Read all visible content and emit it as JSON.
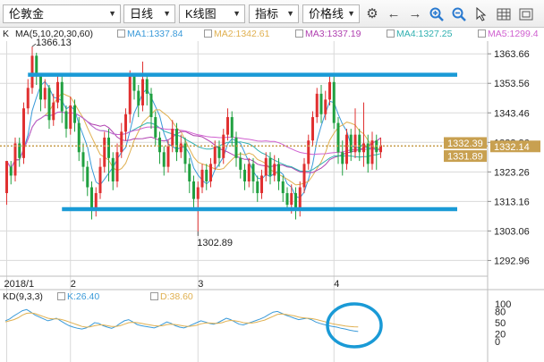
{
  "toolbar": {
    "symbol": "伦敦金",
    "period": "日线",
    "chart_type": "K线图",
    "indicator": "指标",
    "price_line": "价格线"
  },
  "ma_legend": {
    "k_label": "K",
    "params": "MA(5,10,20,30,60)",
    "items": [
      {
        "label": "MA1:1337.84",
        "color": "#3a9ad9"
      },
      {
        "label": "MA2:1342.61",
        "color": "#e0b050"
      },
      {
        "label": "MA3:1337.19",
        "color": "#b040b0"
      },
      {
        "label": "MA4:1327.25",
        "color": "#30b0b0"
      },
      {
        "label": "MA5:1299.4",
        "color": "#d060d0"
      }
    ]
  },
  "kd_legend": {
    "params": "KD(9,3,3)",
    "k_label": "K:26.40",
    "d_label": "D:38.60",
    "k_color": "#3a9ad9",
    "d_color": "#e0b050"
  },
  "colors": {
    "up": "#e03030",
    "down": "#20a040",
    "annotation": "#1a9ad6",
    "axis_text": "#222222",
    "grid": "#d9d9d9",
    "ref_line": "#c8a050",
    "price_box": "#c8a050"
  },
  "chart_data": {
    "type": "candlestick",
    "y_ticks": [
      1363.66,
      1353.56,
      1343.46,
      1333.36,
      1323.26,
      1313.16,
      1303.06,
      1292.96
    ],
    "ylim": [
      1288.5,
      1368.0
    ],
    "x_tick_labels": [
      {
        "label": "2018/1",
        "index": 0
      },
      {
        "label": "2",
        "index": 15
      },
      {
        "label": "3",
        "index": 45
      },
      {
        "label": "4",
        "index": 77
      }
    ],
    "price_boxes": [
      {
        "label": "1332.39",
        "value": 1332.39
      },
      {
        "label": "1332.14",
        "value": 1332.14
      },
      {
        "label": "1331.89",
        "value": 1331.89
      }
    ],
    "reference_price": 1332.14,
    "high_annotation": {
      "label": "1366.13",
      "value": 1366.13,
      "index": 6
    },
    "low_annotation": {
      "label": "1302.89",
      "value": 1302.89,
      "index": 45
    },
    "annotation_lines": [
      {
        "from_index": 5,
        "to_index": 106,
        "value": 1356.5
      },
      {
        "from_index": 13,
        "to_index": 106,
        "value": 1310.5
      }
    ],
    "candles": [
      [
        1316.0,
        1327.0,
        1312.0,
        1325.0
      ],
      [
        1325.0,
        1322.0,
        1319.0,
        1327.0
      ],
      [
        1322.0,
        1333.0,
        1320.0,
        1335.0
      ],
      [
        1333.0,
        1328.0,
        1325.0,
        1335.0
      ],
      [
        1328.0,
        1345.0,
        1326.0,
        1347.0
      ],
      [
        1345.0,
        1352.0,
        1343.0,
        1355.0
      ],
      [
        1352.0,
        1363.0,
        1350.0,
        1366.13
      ],
      [
        1363.0,
        1356.0,
        1353.0,
        1364.0
      ],
      [
        1356.0,
        1348.0,
        1344.0,
        1357.0
      ],
      [
        1348.0,
        1352.0,
        1345.0,
        1355.0
      ],
      [
        1352.0,
        1341.0,
        1338.0,
        1353.0
      ],
      [
        1341.0,
        1347.0,
        1339.0,
        1350.0
      ],
      [
        1347.0,
        1354.0,
        1345.0,
        1356.0
      ],
      [
        1354.0,
        1344.0,
        1340.0,
        1356.0
      ],
      [
        1344.0,
        1338.0,
        1335.0,
        1346.0
      ],
      [
        1338.0,
        1346.0,
        1336.0,
        1349.0
      ],
      [
        1346.0,
        1340.0,
        1337.0,
        1348.0
      ],
      [
        1340.0,
        1330.0,
        1327.0,
        1342.0
      ],
      [
        1330.0,
        1325.0,
        1320.0,
        1333.0
      ],
      [
        1325.0,
        1318.0,
        1315.0,
        1327.0
      ],
      [
        1318.0,
        1310.0,
        1307.0,
        1320.0
      ],
      [
        1310.0,
        1316.0,
        1308.0,
        1318.0
      ],
      [
        1316.0,
        1325.0,
        1314.0,
        1328.0
      ],
      [
        1325.0,
        1335.0,
        1323.0,
        1337.0
      ],
      [
        1335.0,
        1328.0,
        1320.0,
        1338.0
      ],
      [
        1328.0,
        1320.0,
        1317.0,
        1330.0
      ],
      [
        1320.0,
        1330.0,
        1318.0,
        1333.0
      ],
      [
        1330.0,
        1337.0,
        1328.0,
        1340.0
      ],
      [
        1337.0,
        1343.0,
        1334.0,
        1345.0
      ],
      [
        1343.0,
        1356.0,
        1340.0,
        1358.0
      ],
      [
        1356.0,
        1351.0,
        1348.0,
        1357.0
      ],
      [
        1351.0,
        1346.0,
        1342.0,
        1353.0
      ],
      [
        1346.0,
        1355.0,
        1344.0,
        1361.0
      ],
      [
        1355.0,
        1350.0,
        1346.0,
        1357.0
      ],
      [
        1350.0,
        1342.0,
        1338.0,
        1352.0
      ],
      [
        1342.0,
        1335.0,
        1332.0,
        1344.0
      ],
      [
        1335.0,
        1330.0,
        1326.0,
        1337.0
      ],
      [
        1330.0,
        1325.0,
        1322.0,
        1332.0
      ],
      [
        1325.0,
        1332.0,
        1323.0,
        1334.0
      ],
      [
        1332.0,
        1338.0,
        1330.0,
        1341.0
      ],
      [
        1338.0,
        1330.0,
        1327.0,
        1340.0
      ],
      [
        1330.0,
        1333.0,
        1328.0,
        1336.0
      ],
      [
        1333.0,
        1326.0,
        1323.0,
        1335.0
      ],
      [
        1326.0,
        1320.0,
        1316.0,
        1328.0
      ],
      [
        1320.0,
        1314.0,
        1311.0,
        1322.0
      ],
      [
        1314.0,
        1318.0,
        1302.89,
        1320.0
      ],
      [
        1318.0,
        1324.0,
        1316.0,
        1326.0
      ],
      [
        1324.0,
        1320.0,
        1317.0,
        1326.0
      ],
      [
        1320.0,
        1326.0,
        1318.0,
        1328.0
      ],
      [
        1326.0,
        1332.0,
        1324.0,
        1334.0
      ],
      [
        1332.0,
        1328.0,
        1325.0,
        1334.0
      ],
      [
        1328.0,
        1336.0,
        1326.0,
        1338.0
      ],
      [
        1336.0,
        1342.0,
        1334.0,
        1345.0
      ],
      [
        1342.0,
        1335.0,
        1332.0,
        1344.0
      ],
      [
        1335.0,
        1328.0,
        1325.0,
        1337.0
      ],
      [
        1328.0,
        1324.0,
        1321.0,
        1330.0
      ],
      [
        1324.0,
        1320.0,
        1317.0,
        1326.0
      ],
      [
        1320.0,
        1326.0,
        1318.0,
        1328.0
      ],
      [
        1326.0,
        1320.0,
        1316.0,
        1328.0
      ],
      [
        1320.0,
        1316.0,
        1313.0,
        1322.0
      ],
      [
        1316.0,
        1322.0,
        1314.0,
        1324.0
      ],
      [
        1322.0,
        1328.0,
        1320.0,
        1330.0
      ],
      [
        1328.0,
        1322.0,
        1319.0,
        1330.0
      ],
      [
        1322.0,
        1326.0,
        1320.0,
        1329.0
      ],
      [
        1326.0,
        1320.0,
        1317.0,
        1328.0
      ],
      [
        1320.0,
        1316.0,
        1313.0,
        1322.0
      ],
      [
        1316.0,
        1312.0,
        1310.0,
        1318.0
      ],
      [
        1312.0,
        1316.0,
        1309.0,
        1319.0
      ],
      [
        1316.0,
        1310.0,
        1307.0,
        1318.0
      ],
      [
        1310.0,
        1318.0,
        1308.0,
        1320.0
      ],
      [
        1318.0,
        1326.0,
        1316.0,
        1328.0
      ],
      [
        1326.0,
        1334.0,
        1324.0,
        1336.0
      ],
      [
        1334.0,
        1342.0,
        1332.0,
        1344.0
      ],
      [
        1342.0,
        1350.0,
        1340.0,
        1352.0
      ],
      [
        1350.0,
        1343.0,
        1340.0,
        1353.0
      ],
      [
        1343.0,
        1348.0,
        1341.0,
        1351.0
      ],
      [
        1348.0,
        1354.0,
        1346.0,
        1356.0
      ],
      [
        1354.0,
        1340.0,
        1338.0,
        1356.0
      ],
      [
        1340.0,
        1330.0,
        1326.0,
        1342.0
      ],
      [
        1330.0,
        1326.0,
        1322.0,
        1334.0
      ],
      [
        1326.0,
        1336.0,
        1324.0,
        1338.0
      ],
      [
        1336.0,
        1330.0,
        1327.0,
        1338.0
      ],
      [
        1330.0,
        1336.0,
        1328.0,
        1345.0
      ],
      [
        1336.0,
        1330.0,
        1327.0,
        1338.0
      ],
      [
        1330.0,
        1333.0,
        1325.0,
        1347.0
      ],
      [
        1333.0,
        1326.0,
        1323.0,
        1336.0
      ],
      [
        1326.0,
        1334.0,
        1324.0,
        1337.0
      ],
      [
        1334.0,
        1330.0,
        1324.0,
        1336.0
      ],
      [
        1330.0,
        1332.39,
        1328.0,
        1335.0
      ]
    ],
    "kd": {
      "ylim": [
        0,
        100
      ],
      "y_ticks": [
        100,
        80,
        50,
        20,
        0
      ],
      "k": [
        55,
        60,
        68,
        75,
        82,
        85,
        78,
        70,
        65,
        60,
        55,
        58,
        62,
        55,
        48,
        42,
        38,
        35,
        33,
        36,
        42,
        50,
        48,
        42,
        38,
        35,
        40,
        48,
        55,
        58,
        52,
        45,
        42,
        40,
        38,
        36,
        40,
        46,
        52,
        48,
        42,
        38,
        36,
        40,
        45,
        50,
        55,
        52,
        48,
        46,
        50,
        56,
        62,
        58,
        52,
        46,
        44,
        48,
        52,
        56,
        60,
        65,
        72,
        78,
        80,
        75,
        70,
        66,
        62,
        58,
        60,
        62,
        58,
        52,
        48,
        45,
        42,
        40,
        38,
        35,
        33,
        30,
        28,
        26.4
      ],
      "d": [
        52,
        55,
        58,
        63,
        70,
        75,
        76,
        74,
        70,
        66,
        62,
        60,
        60,
        59,
        56,
        52,
        48,
        44,
        40,
        38,
        39,
        42,
        44,
        44,
        42,
        40,
        40,
        42,
        46,
        50,
        51,
        50,
        48,
        46,
        44,
        42,
        41,
        42,
        45,
        46,
        45,
        43,
        41,
        40,
        41,
        43,
        47,
        49,
        49,
        48,
        48,
        50,
        54,
        56,
        55,
        53,
        50,
        49,
        49,
        51,
        54,
        57,
        62,
        67,
        72,
        73,
        72,
        70,
        68,
        65,
        63,
        62,
        61,
        59,
        56,
        53,
        50,
        47,
        45,
        43,
        41,
        40,
        39,
        38.6
      ]
    }
  }
}
